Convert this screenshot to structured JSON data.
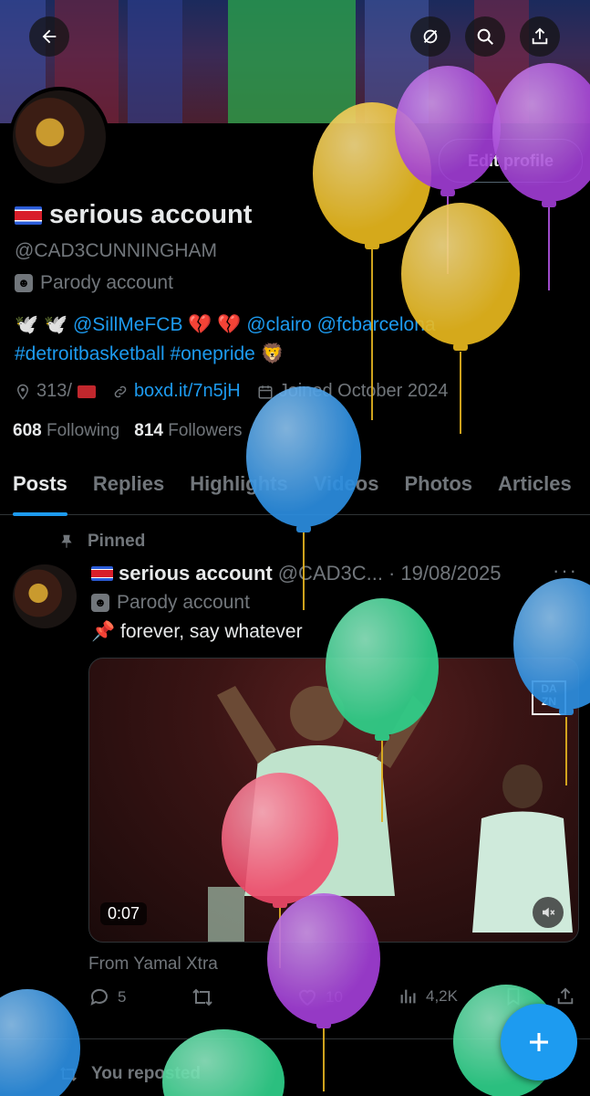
{
  "profile": {
    "edit_label": "Edit profile",
    "display_name": "serious account",
    "handle": "@CAD3CUNNINGHAM",
    "parody_label": "Parody account",
    "bio_emoji_1": "🕊️ 🕊️",
    "bio_mention_1": "@SillMeFCB",
    "bio_emoji_2": "💔 💔",
    "bio_mention_2": "@clairo",
    "bio_mention_3": "@fcbarcelona",
    "bio_tag_1": "#detroitbasketball",
    "bio_tag_2": "#onepride",
    "location": "313/",
    "website": "boxd.it/7n5jH",
    "joined": "Joined October 2024",
    "following_count": "608",
    "following_label": "Following",
    "followers_count": "814",
    "followers_label": "Followers"
  },
  "tabs": [
    "Posts",
    "Replies",
    "Highlights",
    "Videos",
    "Photos",
    "Articles"
  ],
  "pinned_post": {
    "pinned_label": "Pinned",
    "author": "serious account",
    "handle": "@CAD3C...",
    "date": "· 19/08/2025",
    "parody_label": "Parody account",
    "text_emoji": "📌",
    "text": "forever, say whatever",
    "video_duration": "0:07",
    "watermark": "DA ZN",
    "from_label": "From Yamal Xtra",
    "replies": "5",
    "likes": "10",
    "views": "4,2K"
  },
  "next_post": {
    "reposted_label": "You reposted"
  },
  "icons": {
    "back": "back-arrow-icon",
    "grok": "grok-icon",
    "search": "search-icon",
    "share": "share-icon",
    "compose": "plus-icon"
  },
  "colors": {
    "accent": "#1d9bf0",
    "text_secondary": "#71767b"
  }
}
